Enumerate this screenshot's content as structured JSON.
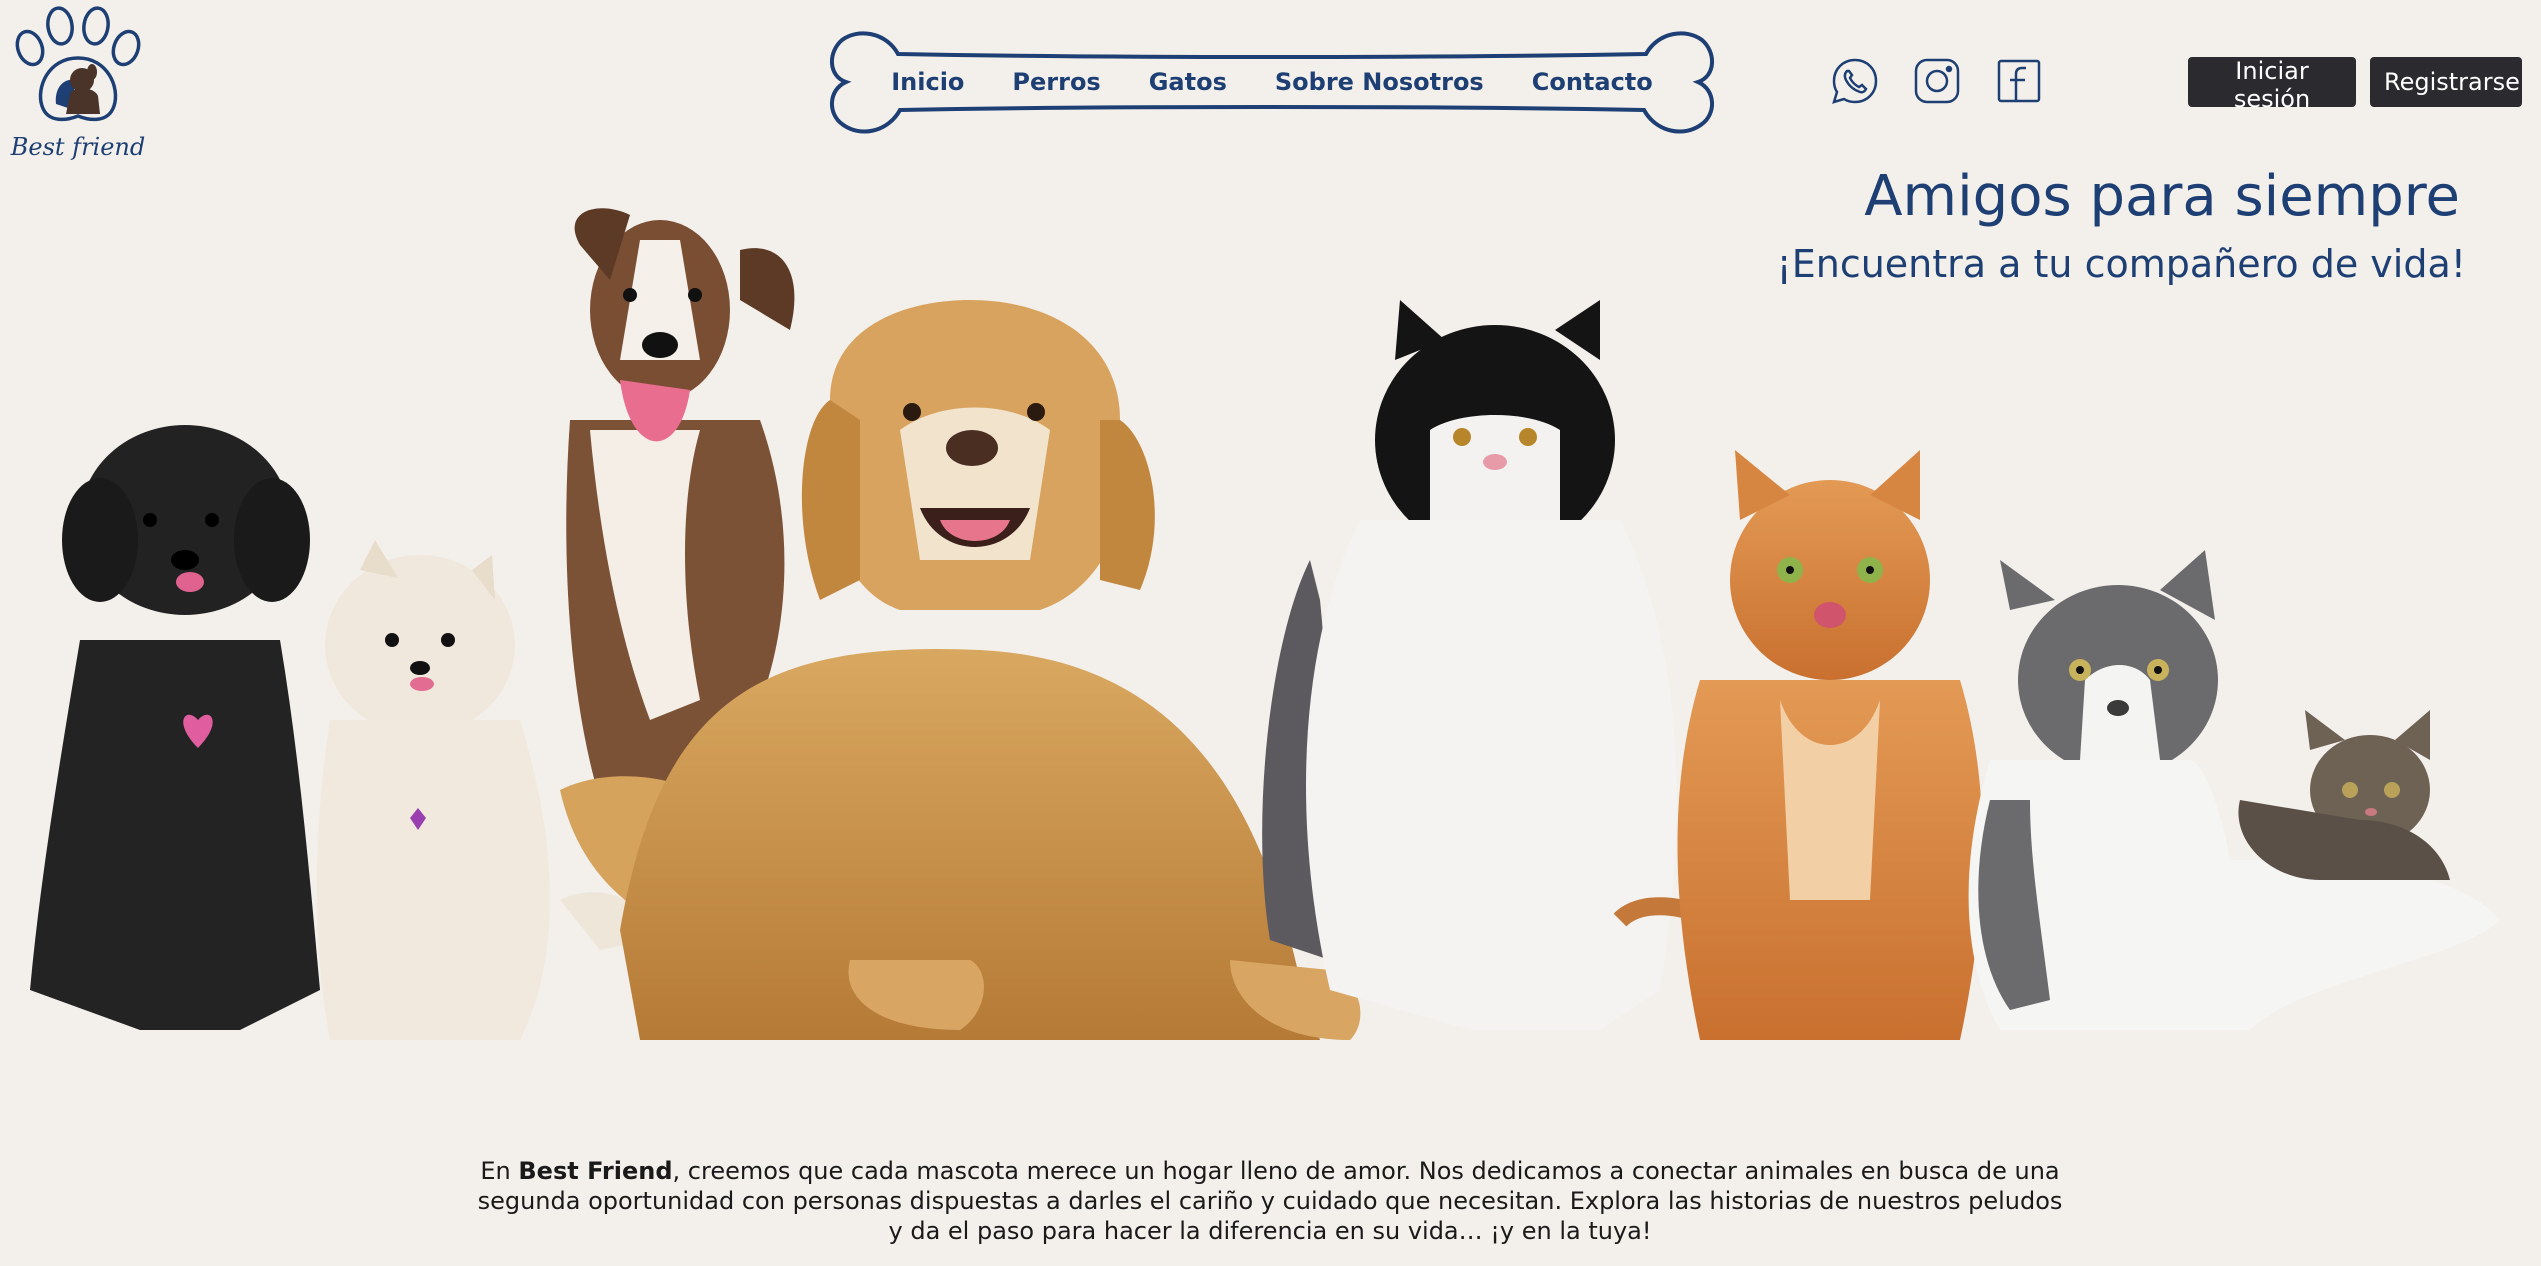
{
  "brand": {
    "name": "Best friend"
  },
  "nav": {
    "items": [
      {
        "label": "Inicio"
      },
      {
        "label": "Perros"
      },
      {
        "label": "Gatos"
      },
      {
        "label": "Sobre Nosotros"
      },
      {
        "label": "Contacto"
      }
    ]
  },
  "social": {
    "icons": [
      "whatsapp-icon",
      "instagram-icon",
      "facebook-icon"
    ]
  },
  "auth": {
    "login_label": "Iniciar sesión",
    "register_label": "Registrarse"
  },
  "hero": {
    "title": "Amigos para siempre",
    "subtitle": "¡Encuentra a tu compañero de vida!"
  },
  "intro": {
    "prefix": "En ",
    "brand": "Best Friend",
    "body": ", creemos que cada mascota merece un hogar lleno de amor. Nos dedicamos a conectar animales en busca de una segunda oportunidad con personas dispuestas a darles el cariño y cuidado que necesitan. Explora las historias de nuestros peludos y da el paso para hacer la diferencia en su vida… ¡y en la tuya!"
  },
  "colors": {
    "brand_blue": "#1d3f73",
    "background": "#f3f0ec",
    "button_dark": "#2b2b2f"
  }
}
